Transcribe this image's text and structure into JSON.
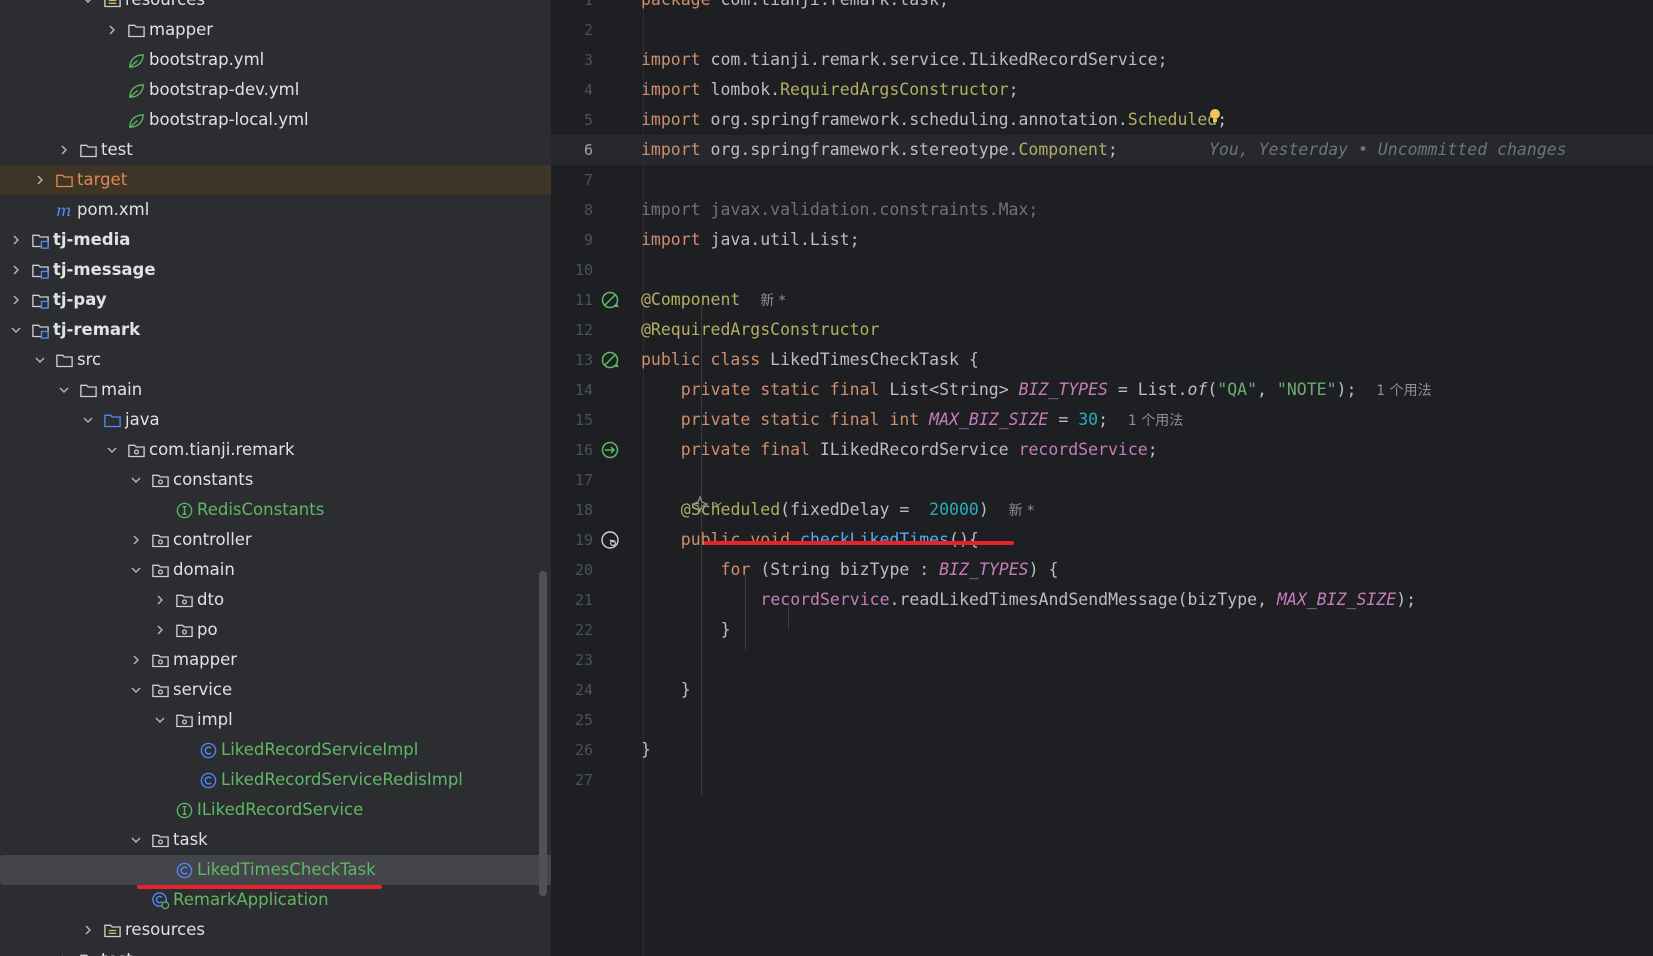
{
  "project_tree": [
    {
      "label": "resources",
      "level": 4,
      "expanded": true,
      "icon": "resources-folder-icon",
      "style": ""
    },
    {
      "label": "mapper",
      "level": 5,
      "expanded": false,
      "icon": "folder-icon",
      "style": ""
    },
    {
      "label": "bootstrap.yml",
      "level": 5,
      "icon": "yaml-spring-icon",
      "style": ""
    },
    {
      "label": "bootstrap-dev.yml",
      "level": 5,
      "icon": "yaml-spring-icon",
      "style": ""
    },
    {
      "label": "bootstrap-local.yml",
      "level": 5,
      "icon": "yaml-spring-icon",
      "style": ""
    },
    {
      "label": "test",
      "level": 3,
      "expanded": false,
      "icon": "folder-icon",
      "style": ""
    },
    {
      "label": "target",
      "level": 2,
      "expanded": false,
      "icon": "target-folder-icon",
      "style": "orange",
      "row": "target-row"
    },
    {
      "label": "pom.xml",
      "level": 2,
      "icon": "maven-icon",
      "style": ""
    },
    {
      "label": "tj-media",
      "level": 1,
      "expanded": false,
      "icon": "module-icon",
      "style": "bold"
    },
    {
      "label": "tj-message",
      "level": 1,
      "expanded": false,
      "icon": "module-icon",
      "style": "bold"
    },
    {
      "label": "tj-pay",
      "level": 1,
      "expanded": false,
      "icon": "module-icon",
      "style": "bold"
    },
    {
      "label": "tj-remark",
      "level": 1,
      "expanded": true,
      "icon": "module-icon",
      "style": "bold"
    },
    {
      "label": "src",
      "level": 2,
      "expanded": true,
      "icon": "folder-icon",
      "style": ""
    },
    {
      "label": "main",
      "level": 3,
      "expanded": true,
      "icon": "folder-icon",
      "style": ""
    },
    {
      "label": "java",
      "level": 4,
      "expanded": true,
      "icon": "source-folder-icon",
      "style": ""
    },
    {
      "label": "com.tianji.remark",
      "level": 5,
      "expanded": true,
      "icon": "package-icon",
      "style": ""
    },
    {
      "label": "constants",
      "level": 6,
      "expanded": true,
      "icon": "package-icon",
      "style": ""
    },
    {
      "label": "RedisConstants",
      "level": 7,
      "icon": "interface-icon",
      "style": "green"
    },
    {
      "label": "controller",
      "level": 6,
      "expanded": false,
      "icon": "package-icon",
      "style": ""
    },
    {
      "label": "domain",
      "level": 6,
      "expanded": true,
      "icon": "package-icon",
      "style": ""
    },
    {
      "label": "dto",
      "level": 7,
      "expanded": false,
      "icon": "package-icon",
      "style": ""
    },
    {
      "label": "po",
      "level": 7,
      "expanded": false,
      "icon": "package-icon",
      "style": ""
    },
    {
      "label": "mapper",
      "level": 6,
      "expanded": false,
      "icon": "package-icon",
      "style": ""
    },
    {
      "label": "service",
      "level": 6,
      "expanded": true,
      "icon": "package-icon",
      "style": ""
    },
    {
      "label": "impl",
      "level": 7,
      "expanded": true,
      "icon": "package-icon",
      "style": ""
    },
    {
      "label": "LikedRecordServiceImpl",
      "level": 8,
      "icon": "class-icon",
      "style": "green"
    },
    {
      "label": "LikedRecordServiceRedisImpl",
      "level": 8,
      "icon": "class-icon",
      "style": "green"
    },
    {
      "label": "ILikedRecordService",
      "level": 7,
      "icon": "interface-icon",
      "style": "green"
    },
    {
      "label": "task",
      "level": 6,
      "expanded": true,
      "icon": "package-icon",
      "style": ""
    },
    {
      "label": "LikedTimesCheckTask",
      "level": 7,
      "icon": "class-icon",
      "style": "green",
      "row": "selected"
    },
    {
      "label": "RemarkApplication",
      "level": 6,
      "icon": "spring-boot-class-icon",
      "style": "green"
    },
    {
      "label": "resources",
      "level": 4,
      "expanded": false,
      "icon": "resources-folder-icon",
      "style": ""
    },
    {
      "label": "test",
      "level": 3,
      "expanded": false,
      "icon": "folder-icon",
      "style": ""
    }
  ],
  "editor": {
    "lines": [
      {
        "n": "1",
        "tokens": [
          [
            "kw",
            "package"
          ],
          [
            "",
            "com.tianji.remark.task;"
          ]
        ]
      },
      {
        "n": "2",
        "tokens": []
      },
      {
        "n": "3",
        "tokens": [
          [
            "kw",
            "import"
          ],
          [
            "",
            "com.tianji.remark.service.ILikedRecordService;"
          ]
        ]
      },
      {
        "n": "4",
        "tokens": [
          [
            "kw",
            "import"
          ],
          [
            "",
            "lombok."
          ],
          [
            "cls",
            "RequiredArgsConstructor"
          ],
          [
            "",
            ";"
          ]
        ]
      },
      {
        "n": "5",
        "tokens": [
          [
            "kw",
            "import"
          ],
          [
            "",
            "org.springframework.scheduling.annotation."
          ],
          [
            "cls",
            "Scheduled"
          ],
          [
            "",
            ";"
          ]
        ]
      },
      {
        "n": "6",
        "current": true,
        "tokens": [
          [
            "kw",
            "import"
          ],
          [
            "",
            "org.springframework.stereotype."
          ],
          [
            "cls",
            "Component"
          ],
          [
            "",
            ";"
          ]
        ]
      },
      {
        "n": "7",
        "tokens": []
      },
      {
        "n": "8",
        "tokens": [
          [
            "dim",
            "import javax.validation.constraints.Max;"
          ]
        ]
      },
      {
        "n": "9",
        "tokens": [
          [
            "kw",
            "import"
          ],
          [
            "",
            "java.util.List;"
          ]
        ]
      },
      {
        "n": "10",
        "tokens": []
      },
      {
        "n": "11",
        "gutter": "bean-icon",
        "tokens": [
          [
            "ann",
            "@Component"
          ],
          [
            "hint",
            "新 *"
          ]
        ]
      },
      {
        "n": "12",
        "tokens": [
          [
            "ann",
            "@RequiredArgsConstructor"
          ]
        ]
      },
      {
        "n": "13",
        "gutter": "bean-icon",
        "tokens": [
          [
            "kw",
            "public class"
          ],
          [
            "",
            "LikedTimesCheckTask {"
          ]
        ]
      },
      {
        "n": "14",
        "indent": 1,
        "tokens": [
          [
            "kw",
            "private static final"
          ],
          [
            "",
            "List<String>"
          ],
          [
            "istatic",
            "BIZ_TYPES"
          ],
          [
            "",
            "= List."
          ],
          [
            "ital",
            "of"
          ],
          [
            "",
            "("
          ],
          [
            "str",
            "\"QA\""
          ],
          [
            "",
            ","
          ],
          [
            "str",
            "\"NOTE\""
          ],
          [
            "",
            ");"
          ],
          [
            "hint",
            "1 个用法"
          ]
        ]
      },
      {
        "n": "15",
        "indent": 1,
        "tokens": [
          [
            "kw",
            "private static final int"
          ],
          [
            "istatic",
            "MAX_BIZ_SIZE"
          ],
          [
            "",
            "="
          ],
          [
            "num",
            "30"
          ],
          [
            "",
            ";"
          ],
          [
            "hint",
            "1 个用法"
          ]
        ]
      },
      {
        "n": "16",
        "indent": 1,
        "gutter": "inject-icon",
        "tokens": [
          [
            "kw",
            "private final"
          ],
          [
            "",
            "ILikedRecordService"
          ],
          [
            "field",
            "recordService"
          ],
          [
            "",
            ";"
          ]
        ]
      },
      {
        "n": "17",
        "tokens": []
      },
      {
        "n": "18",
        "indent": 1,
        "tokens": [
          [
            "ann",
            "@Scheduled"
          ],
          [
            "",
            "(fixedDelay = "
          ],
          [
            "num",
            "20000"
          ],
          [
            "",
            ")"
          ],
          [
            "hint",
            "新 *"
          ]
        ]
      },
      {
        "n": "19",
        "indent": 1,
        "gutter": "clock-icon",
        "tokens": [
          [
            "kw",
            "public void"
          ],
          [
            "fn",
            "checkLikedTimes"
          ],
          [
            "",
            "(){"
          ]
        ]
      },
      {
        "n": "20",
        "indent": 2,
        "tokens": [
          [
            "kw",
            "for"
          ],
          [
            "",
            "(String bizType :"
          ],
          [
            "istatic",
            "BIZ_TYPES"
          ],
          [
            "",
            ") {"
          ]
        ]
      },
      {
        "n": "21",
        "indent": 3,
        "tokens": [
          [
            "field",
            "recordService"
          ],
          [
            "",
            ".readLikedTimesAndSendMessage(bizType,"
          ],
          [
            "istatic",
            "MAX_BIZ_SIZE"
          ],
          [
            "",
            ");"
          ]
        ]
      },
      {
        "n": "22",
        "indent": 2,
        "tokens": [
          [
            "",
            "}"
          ]
        ]
      },
      {
        "n": "23",
        "tokens": []
      },
      {
        "n": "24",
        "indent": 1,
        "tokens": [
          [
            "",
            "}"
          ]
        ]
      },
      {
        "n": "25",
        "tokens": []
      },
      {
        "n": "26",
        "tokens": [
          [
            "",
            "}"
          ]
        ]
      },
      {
        "n": "27",
        "tokens": []
      }
    ],
    "blame_annotation": "You, Yesterday • Uncommitted changes"
  },
  "colors": {
    "annotation_underline": "#e8222a",
    "tree_bg": "#2b2d30",
    "editor_bg": "#1e1f22"
  }
}
